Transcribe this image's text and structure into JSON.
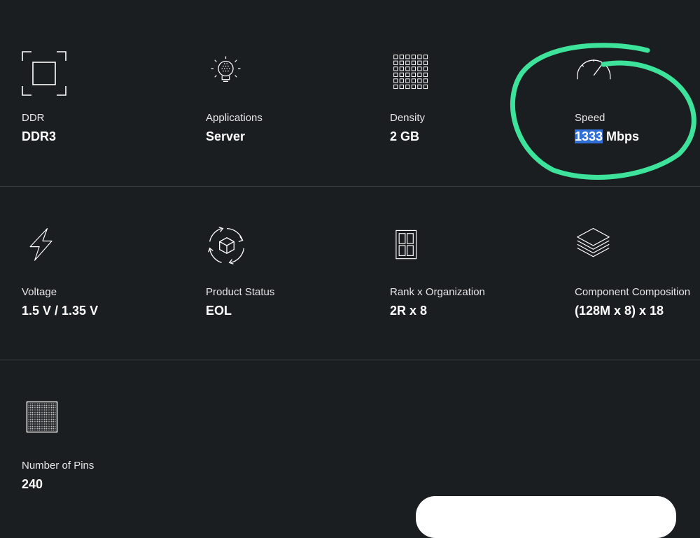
{
  "specs": [
    {
      "label": "DDR",
      "value": "DDR3",
      "icon": "frame-icon"
    },
    {
      "label": "Applications",
      "value": "Server",
      "icon": "lightbulb-icon"
    },
    {
      "label": "Density",
      "value": "2 GB",
      "icon": "grid-icon"
    },
    {
      "label": "Speed",
      "value_highlight": "1333",
      "value_unit": " Mbps",
      "icon": "speedometer-icon"
    },
    {
      "label": "Voltage",
      "value": "1.5 V / 1.35 V",
      "icon": "lightning-icon"
    },
    {
      "label": "Product Status",
      "value": "EOL",
      "icon": "cube-cycle-icon"
    },
    {
      "label": "Rank x Organization",
      "value": "2R x 8",
      "icon": "rank-blocks-icon"
    },
    {
      "label": "Component Composition",
      "value": "(128M x 8) x 18",
      "icon": "layers-icon"
    },
    {
      "label": "Number of Pins",
      "value": "240",
      "icon": "pin-grid-icon"
    }
  ],
  "colors": {
    "background": "#1b1e20",
    "annotation": "#3de39a",
    "selection": "#2f6fd6"
  }
}
